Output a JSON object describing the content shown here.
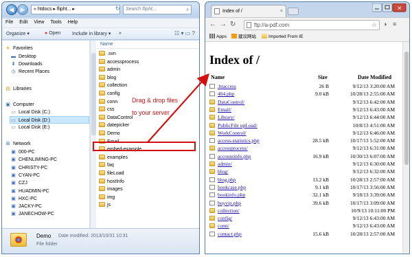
{
  "explorer": {
    "address_crumbs": "«  htdocs ▸ flipht... ▸",
    "search_placeholder": "Search flipht...",
    "menu": [
      "File",
      "Edit",
      "View",
      "Tools",
      "Help"
    ],
    "toolbar": {
      "organize": "Organize ▾",
      "open": "Open",
      "include": "Include in library ▾",
      "more": "»"
    },
    "nav": {
      "favorites_header": "Favorites",
      "favorites": [
        "Desktop",
        "Downloads",
        "Recent Places"
      ],
      "libraries_header": "Libraries",
      "computer_header": "Computer",
      "drives": [
        "Local Disk (C:)",
        "Local Disk (D:)",
        "Local Disk (E:)"
      ],
      "network_header": "Network",
      "network": [
        "000-PC",
        "CHENLIMING-PC",
        "CHRISTY-PC",
        "CYAN-PC",
        "CZJ",
        "HUADMIN-PC",
        "HXC-PC",
        "JACKY-PC",
        "JANECHOW-PC"
      ]
    },
    "column_name": "Name",
    "files": [
      {
        "name": ".svn",
        "type": "folder"
      },
      {
        "name": "accessprocess",
        "type": "folder"
      },
      {
        "name": "admin",
        "type": "folder"
      },
      {
        "name": "blog",
        "type": "folder"
      },
      {
        "name": "collection",
        "type": "folder"
      },
      {
        "name": "config",
        "type": "folder"
      },
      {
        "name": "conn",
        "type": "folder"
      },
      {
        "name": "css",
        "type": "folder"
      },
      {
        "name": "DataControl",
        "type": "folder"
      },
      {
        "name": "datepicker",
        "type": "folder"
      },
      {
        "name": "Demo",
        "type": "folder"
      },
      {
        "name": "Email",
        "type": "folder"
      },
      {
        "name": "embed-example",
        "type": "folder"
      },
      {
        "name": "examples",
        "type": "folder"
      },
      {
        "name": "faq",
        "type": "folder"
      },
      {
        "name": "fileLoad",
        "type": "folder"
      },
      {
        "name": "hostInfo",
        "type": "folder"
      },
      {
        "name": "images",
        "type": "folder"
      },
      {
        "name": "img",
        "type": "folder"
      },
      {
        "name": "js",
        "type": "folder"
      }
    ],
    "details": {
      "name": "Demo",
      "modified": "Date modified: 2013/10/31 10:31",
      "type": "File folder"
    }
  },
  "annotation": {
    "line1": "Drag & drop files",
    "line2": "to your server",
    "color": "#d40f0f"
  },
  "browser": {
    "tab_title": "Index of /",
    "url": "ftp://a-pdf.com",
    "bookmarks": [
      "Apps",
      "建议网站",
      "Imported From IE"
    ],
    "page_title": "Index of /",
    "headers": {
      "name": "Name",
      "size": "Size",
      "date": "Date Modified"
    },
    "entries": [
      {
        "name": ".htaccess",
        "size": "26 B",
        "date": "9/12/13 3:20:00 AM",
        "type": "file"
      },
      {
        "name": "404.php",
        "size": "9.0 kB",
        "date": "10/28/13 2:55:00 AM",
        "type": "file"
      },
      {
        "name": "DataControl/",
        "size": "",
        "date": "9/12/13 6:42:00 AM",
        "type": "folder"
      },
      {
        "name": "Email/",
        "size": "",
        "date": "9/12/13 6:43:00 AM",
        "type": "folder"
      },
      {
        "name": "Library/",
        "size": "",
        "date": "9/12/13 6:44:00 AM",
        "type": "folder"
      },
      {
        "name": "PublicFile upLoad/",
        "size": "",
        "date": "10/8/13 4:51:00 AM",
        "type": "folder"
      },
      {
        "name": "WorkControl/",
        "size": "",
        "date": "9/12/13 6:46:00 AM",
        "type": "folder"
      },
      {
        "name": "access-statistics.php",
        "size": "28.5 kB",
        "date": "10/17/13 5:52:00 AM",
        "type": "file"
      },
      {
        "name": "accessprocess/",
        "size": "",
        "date": "9/12/13 6:31:00 AM",
        "type": "folder"
      },
      {
        "name": "accountinfo.php",
        "size": "16.9 kB",
        "date": "10/30/13 6:07:00 AM",
        "type": "file"
      },
      {
        "name": "admin/",
        "size": "",
        "date": "9/12/13 6:30:00 AM",
        "type": "folder"
      },
      {
        "name": "blog/",
        "size": "",
        "date": "9/12/13 6:32:00 AM",
        "type": "folder"
      },
      {
        "name": "blog.php",
        "size": "13.2 kB",
        "date": "10/28/13 2:57:00 AM",
        "type": "file"
      },
      {
        "name": "bookcase.php",
        "size": "9.1 kB",
        "date": "10/17/13 3:56:00 AM",
        "type": "file"
      },
      {
        "name": "bookinfo.php",
        "size": "32.1 kB",
        "date": "9/18/13 3:39:00 AM",
        "type": "file"
      },
      {
        "name": "buyvip.php",
        "size": "39.6 kB",
        "date": "10/17/13 3:09:00 AM",
        "type": "file"
      },
      {
        "name": "collection/",
        "size": "",
        "date": "10/9/13 10:11:00 PM",
        "type": "folder"
      },
      {
        "name": "config/",
        "size": "",
        "date": "9/12/13 6:43:00 AM",
        "type": "folder"
      },
      {
        "name": "conn/",
        "size": "",
        "date": "9/12/13 6:43:00 AM",
        "type": "folder"
      },
      {
        "name": "contact.php",
        "size": "15.6 kB",
        "date": "10/28/13 2:57:00 AM",
        "type": "file"
      }
    ]
  }
}
